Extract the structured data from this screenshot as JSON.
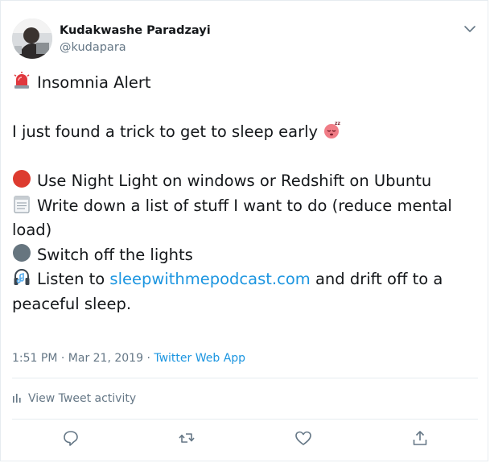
{
  "author": {
    "display_name": "Kudakwashe Paradzayi",
    "handle": "@kudapara"
  },
  "tweet": {
    "title_line": "Insomnia Alert",
    "intro_line": "I just found a trick to get to sleep early",
    "items": [
      {
        "icon": "red-circle-icon",
        "text": "Use Night Light on windows or Redshift on Ubuntu"
      },
      {
        "icon": "notepad-icon",
        "text": "Write down a list of stuff I want to do (reduce mental load)"
      },
      {
        "icon": "black-circle-icon",
        "text": "Switch off the lights"
      },
      {
        "icon": "headphones-icon",
        "text_before": "Listen to",
        "link": "sleepwithmepodcast.com",
        "text_after": "and drift off to a peaceful sleep."
      }
    ]
  },
  "meta": {
    "time": "1:51 PM",
    "separator": "·",
    "date": "Mar 21, 2019",
    "source": "Twitter Web App"
  },
  "activity_label": "View Tweet activity",
  "actions": [
    "reply-icon",
    "retweet-icon",
    "like-icon",
    "share-icon"
  ],
  "colors": {
    "link": "#1b95e0",
    "secondary_text": "#657786",
    "primary_text": "#14171a",
    "divider": "#e6ecf0"
  }
}
